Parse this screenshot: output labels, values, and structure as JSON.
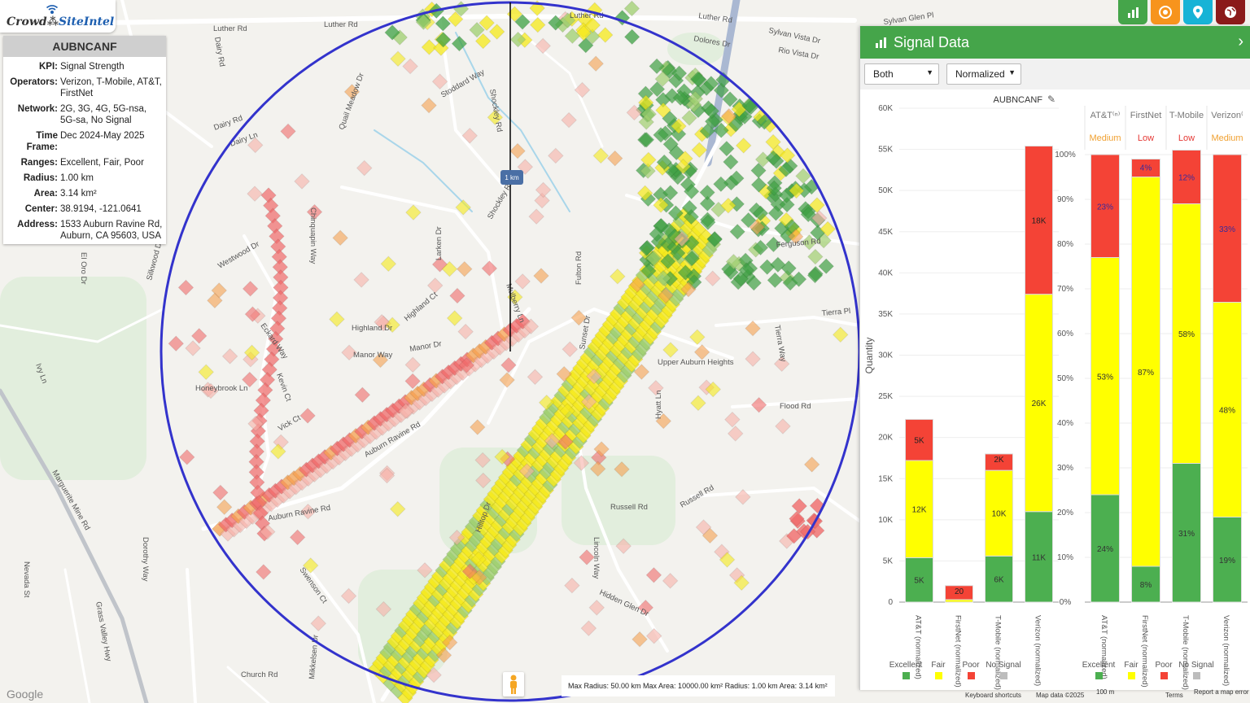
{
  "app": {
    "logo_a": "Crowd",
    "logo_b": "SiteIntel",
    "google": "Google"
  },
  "info": {
    "title": "AUBNCANF",
    "rows": [
      {
        "k": "KPI:",
        "v": "Signal Strength"
      },
      {
        "k": "Operators:",
        "v": "Verizon, T-Mobile, AT&T, FirstNet"
      },
      {
        "k": "Network:",
        "v": "2G, 3G, 4G, 5G-nsa, 5G-sa, No Signal"
      },
      {
        "k": "Time Frame:",
        "v": "Dec 2024-May 2025"
      },
      {
        "k": "Ranges:",
        "v": "Excellent, Fair, Poor"
      },
      {
        "k": "Radius:",
        "v": "1.00 km"
      },
      {
        "k": "Area:",
        "v": "3.14 km²"
      },
      {
        "k": "Center:",
        "v": "38.9194, -121.0641"
      },
      {
        "k": "Address:",
        "v": "1533 Auburn Ravine Rd, Auburn, CA 95603, USA"
      }
    ]
  },
  "map": {
    "radius_label": "1 km",
    "footer": "Max Radius: 50.00 km  Max Area: 10000.00 km²  Radius: 1.00 km  Area: 3.14 km²",
    "keyboard": "Keyboard shortcuts",
    "mapdata": "Map data ©2025",
    "scale": "100 m",
    "terms": "Terms",
    "report": "Report a map error",
    "streets": [
      {
        "t": "Luther Rd"
      },
      {
        "t": "Luther Rd"
      },
      {
        "t": "Luther Rd"
      },
      {
        "t": "Luther Rd"
      },
      {
        "t": "Dolores Dr"
      },
      {
        "t": "Sylvan Vista Dr"
      },
      {
        "t": "Rio Vista Dr"
      },
      {
        "t": "Sylvan Glen Pl"
      },
      {
        "t": "Dairy Rd"
      },
      {
        "t": "Dairy Rd"
      },
      {
        "t": "Dairy Ln"
      },
      {
        "t": "Quail Meadow Dr"
      },
      {
        "t": "Shockley Rd"
      },
      {
        "t": "Shockley Rd"
      },
      {
        "t": "Highland Dr"
      },
      {
        "t": "Highland Ct"
      },
      {
        "t": "Manor Way"
      },
      {
        "t": "Manor Dr"
      },
      {
        "t": "Upper Auburn Heights"
      },
      {
        "t": "Ferguson Rd"
      },
      {
        "t": "Tierra Pl"
      },
      {
        "t": "Tierra Way"
      },
      {
        "t": "Flood Rd"
      },
      {
        "t": "Russell Rd"
      },
      {
        "t": "Russell Rd"
      },
      {
        "t": "Auburn Ravine Rd"
      },
      {
        "t": "Auburn Ravine Rd"
      },
      {
        "t": "Honeybrook Ln"
      },
      {
        "t": "Vick Ct"
      },
      {
        "t": "Westwood Dr"
      },
      {
        "t": "Marguerite Mine Rd"
      },
      {
        "t": "Grass Valley Hwy"
      },
      {
        "t": "Nevada St"
      },
      {
        "t": "Dorothy Way"
      },
      {
        "t": "Church Rd"
      },
      {
        "t": "Mikkelsen Dr"
      },
      {
        "t": "Swenson Ct"
      },
      {
        "t": "Lincoln Way"
      },
      {
        "t": "Hilltop Dr"
      },
      {
        "t": "Fulton Rd"
      },
      {
        "t": "Kevin Ct"
      },
      {
        "t": "Eckard Way"
      },
      {
        "t": "Larken Dr"
      },
      {
        "t": "Stoddard Way"
      },
      {
        "t": "El Oro Dr"
      },
      {
        "t": "Silkwood Dr"
      },
      {
        "t": "Hidden Glen Dr"
      },
      {
        "t": "Hyatt Ln"
      },
      {
        "t": "Mulberry Ln"
      },
      {
        "t": "Sunset Dr"
      },
      {
        "t": "Chinquapin Way"
      },
      {
        "t": "Ivy Ln"
      }
    ]
  },
  "panel": {
    "title": "Signal Data",
    "select1": "Both",
    "select2": "Normalized",
    "colors": {
      "header": "#45a54a",
      "excellent": "#4caf50",
      "fair": "#ffff00",
      "poor": "#f44336",
      "no_signal": "#bdbdbd",
      "medium": "#f0a030",
      "low": "#e53935"
    },
    "legend": [
      "Excellent",
      "Fair",
      "Poor",
      "No Signal"
    ]
  },
  "chart_data": [
    {
      "type": "bar",
      "stacked": true,
      "title": "AUBNCANF",
      "ylabel": "Quantity",
      "ylim": [
        0,
        60000
      ],
      "yticks": [
        "0",
        "5K",
        "10K",
        "15K",
        "20K",
        "25K",
        "30K",
        "35K",
        "40K",
        "45K",
        "50K",
        "55K",
        "60K"
      ],
      "categories": [
        "AT&T (normalized)",
        "FirstNet (normalized)",
        "T-Mobile (normalized)",
        "Verizon (normalized)"
      ],
      "series": [
        {
          "name": "Excellent",
          "values": [
            5400,
            0,
            5600,
            11000
          ],
          "labels": [
            "5K",
            "",
            "6K",
            "11K"
          ]
        },
        {
          "name": "Fair",
          "values": [
            11800,
            300,
            10400,
            26400
          ],
          "labels": [
            "12K",
            "",
            "10K",
            "26K"
          ]
        },
        {
          "name": "Poor",
          "values": [
            5000,
            1700,
            2000,
            18000
          ],
          "labels": [
            "5K",
            "20",
            "2K",
            "18K"
          ]
        },
        {
          "name": "No Signal",
          "values": [
            0,
            0,
            0,
            0
          ],
          "labels": [
            "",
            "",
            "",
            ""
          ]
        }
      ]
    },
    {
      "type": "bar",
      "stacked": true,
      "percent": true,
      "ylim": [
        0,
        100
      ],
      "yticks": [
        "0%",
        "10%",
        "20%",
        "30%",
        "40%",
        "50%",
        "60%",
        "70%",
        "80%",
        "90%",
        "100%"
      ],
      "categories": [
        "AT&T (normalized)",
        "FirstNet (normalized)",
        "T-Mobile (normalized)",
        "Verizon (normalized)"
      ],
      "column_headers": [
        "AT&T⁽ⁿ⁾",
        "FirstNet",
        "T-Mobile",
        "Verizon⁽"
      ],
      "ratings": [
        "Medium",
        "Low",
        "Low",
        "Medium"
      ],
      "series": [
        {
          "name": "Excellent",
          "values": [
            24,
            8,
            31,
            19
          ],
          "labels": [
            "24%",
            "8%",
            "31%",
            "19%"
          ]
        },
        {
          "name": "Fair",
          "values": [
            53,
            87,
            58,
            48
          ],
          "labels": [
            "53%",
            "87%",
            "58%",
            "48%"
          ]
        },
        {
          "name": "Poor",
          "values": [
            23,
            4,
            12,
            33
          ],
          "labels": [
            "23%",
            "4%",
            "12%",
            "33%"
          ]
        },
        {
          "name": "No Signal",
          "values": [
            0,
            0,
            0,
            0
          ],
          "labels": [
            "",
            "",
            "",
            ""
          ]
        }
      ]
    }
  ]
}
